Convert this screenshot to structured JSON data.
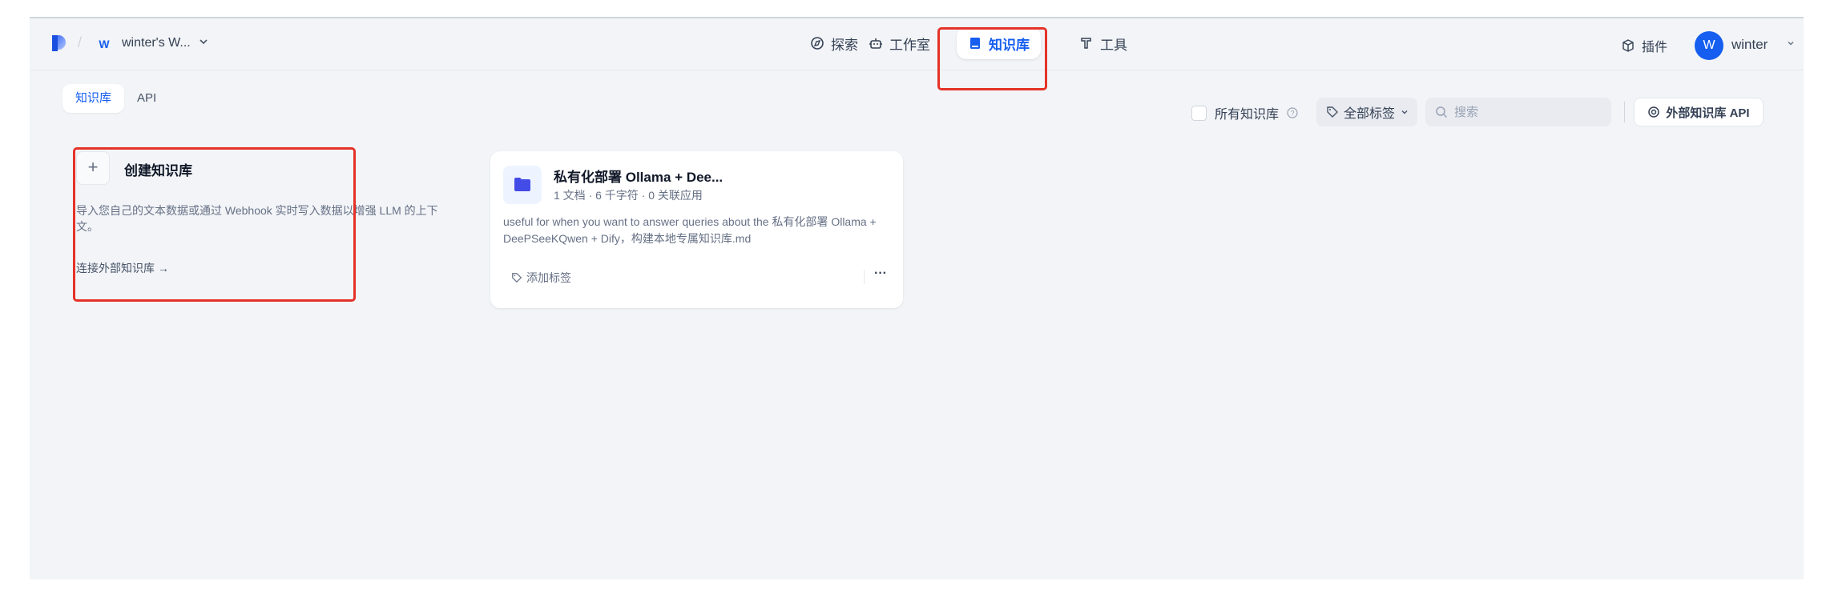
{
  "header": {
    "workspace_initial": "W",
    "workspace_name": "winter's W...",
    "nav": [
      {
        "label": "探索",
        "icon": "compass-icon"
      },
      {
        "label": "工作室",
        "icon": "robot-icon"
      },
      {
        "label": "知识库",
        "icon": "book-icon",
        "active": true
      },
      {
        "label": "工具",
        "icon": "hammer-icon"
      }
    ],
    "plugins_label": "插件",
    "user_initial": "W",
    "user_name": "winter"
  },
  "tabs": [
    {
      "label": "知识库",
      "active": true
    },
    {
      "label": "API",
      "active": false
    }
  ],
  "filters": {
    "all_kb_label": "所有知识库",
    "all_tags_label": "全部标签",
    "search_placeholder": "搜索",
    "external_api_label": "外部知识库 API"
  },
  "create_card": {
    "plus": "+",
    "title": "创建知识库",
    "description": "导入您自己的文本数据或通过 Webhook 实时写入数据以增强 LLM 的上下文。",
    "link": "连接外部知识库 →"
  },
  "datasets": [
    {
      "title": "私有化部署 Ollama + Dee...",
      "meta": "1 文档 · 6 千字符 · 0 关联应用",
      "description": "useful for when you want to answer queries about the 私有化部署 Ollama + DeePSeeKQwen + Dify，构建本地专属知识库.md",
      "tag_label": "添加标签",
      "more": "···"
    }
  ],
  "colors": {
    "accent": "#155eef",
    "highlight": "#e53228",
    "background": "#f2f4f7"
  }
}
